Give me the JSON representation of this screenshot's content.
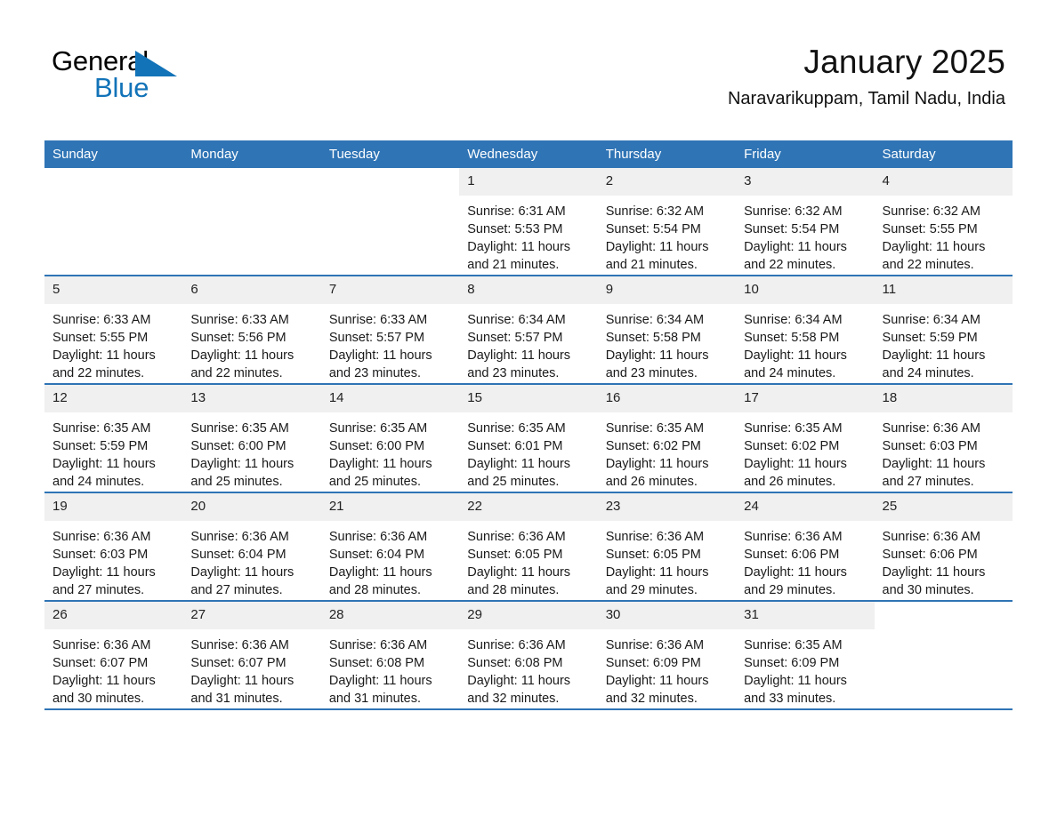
{
  "brand": {
    "name_part1": "General",
    "name_part2": "Blue",
    "accent_color": "#1273b8"
  },
  "header": {
    "title": "January 2025",
    "subtitle": "Naravarikuppam, Tamil Nadu, India",
    "header_bg_color": "#2f74b5"
  },
  "weekdays": [
    "Sunday",
    "Monday",
    "Tuesday",
    "Wednesday",
    "Thursday",
    "Friday",
    "Saturday"
  ],
  "weeks": [
    [
      {
        "day": "",
        "sunrise": "",
        "sunset": "",
        "daylight_line1": "",
        "daylight_line2": ""
      },
      {
        "day": "",
        "sunrise": "",
        "sunset": "",
        "daylight_line1": "",
        "daylight_line2": ""
      },
      {
        "day": "",
        "sunrise": "",
        "sunset": "",
        "daylight_line1": "",
        "daylight_line2": ""
      },
      {
        "day": "1",
        "sunrise": "Sunrise: 6:31 AM",
        "sunset": "Sunset: 5:53 PM",
        "daylight_line1": "Daylight: 11 hours",
        "daylight_line2": "and 21 minutes."
      },
      {
        "day": "2",
        "sunrise": "Sunrise: 6:32 AM",
        "sunset": "Sunset: 5:54 PM",
        "daylight_line1": "Daylight: 11 hours",
        "daylight_line2": "and 21 minutes."
      },
      {
        "day": "3",
        "sunrise": "Sunrise: 6:32 AM",
        "sunset": "Sunset: 5:54 PM",
        "daylight_line1": "Daylight: 11 hours",
        "daylight_line2": "and 22 minutes."
      },
      {
        "day": "4",
        "sunrise": "Sunrise: 6:32 AM",
        "sunset": "Sunset: 5:55 PM",
        "daylight_line1": "Daylight: 11 hours",
        "daylight_line2": "and 22 minutes."
      }
    ],
    [
      {
        "day": "5",
        "sunrise": "Sunrise: 6:33 AM",
        "sunset": "Sunset: 5:55 PM",
        "daylight_line1": "Daylight: 11 hours",
        "daylight_line2": "and 22 minutes."
      },
      {
        "day": "6",
        "sunrise": "Sunrise: 6:33 AM",
        "sunset": "Sunset: 5:56 PM",
        "daylight_line1": "Daylight: 11 hours",
        "daylight_line2": "and 22 minutes."
      },
      {
        "day": "7",
        "sunrise": "Sunrise: 6:33 AM",
        "sunset": "Sunset: 5:57 PM",
        "daylight_line1": "Daylight: 11 hours",
        "daylight_line2": "and 23 minutes."
      },
      {
        "day": "8",
        "sunrise": "Sunrise: 6:34 AM",
        "sunset": "Sunset: 5:57 PM",
        "daylight_line1": "Daylight: 11 hours",
        "daylight_line2": "and 23 minutes."
      },
      {
        "day": "9",
        "sunrise": "Sunrise: 6:34 AM",
        "sunset": "Sunset: 5:58 PM",
        "daylight_line1": "Daylight: 11 hours",
        "daylight_line2": "and 23 minutes."
      },
      {
        "day": "10",
        "sunrise": "Sunrise: 6:34 AM",
        "sunset": "Sunset: 5:58 PM",
        "daylight_line1": "Daylight: 11 hours",
        "daylight_line2": "and 24 minutes."
      },
      {
        "day": "11",
        "sunrise": "Sunrise: 6:34 AM",
        "sunset": "Sunset: 5:59 PM",
        "daylight_line1": "Daylight: 11 hours",
        "daylight_line2": "and 24 minutes."
      }
    ],
    [
      {
        "day": "12",
        "sunrise": "Sunrise: 6:35 AM",
        "sunset": "Sunset: 5:59 PM",
        "daylight_line1": "Daylight: 11 hours",
        "daylight_line2": "and 24 minutes."
      },
      {
        "day": "13",
        "sunrise": "Sunrise: 6:35 AM",
        "sunset": "Sunset: 6:00 PM",
        "daylight_line1": "Daylight: 11 hours",
        "daylight_line2": "and 25 minutes."
      },
      {
        "day": "14",
        "sunrise": "Sunrise: 6:35 AM",
        "sunset": "Sunset: 6:00 PM",
        "daylight_line1": "Daylight: 11 hours",
        "daylight_line2": "and 25 minutes."
      },
      {
        "day": "15",
        "sunrise": "Sunrise: 6:35 AM",
        "sunset": "Sunset: 6:01 PM",
        "daylight_line1": "Daylight: 11 hours",
        "daylight_line2": "and 25 minutes."
      },
      {
        "day": "16",
        "sunrise": "Sunrise: 6:35 AM",
        "sunset": "Sunset: 6:02 PM",
        "daylight_line1": "Daylight: 11 hours",
        "daylight_line2": "and 26 minutes."
      },
      {
        "day": "17",
        "sunrise": "Sunrise: 6:35 AM",
        "sunset": "Sunset: 6:02 PM",
        "daylight_line1": "Daylight: 11 hours",
        "daylight_line2": "and 26 minutes."
      },
      {
        "day": "18",
        "sunrise": "Sunrise: 6:36 AM",
        "sunset": "Sunset: 6:03 PM",
        "daylight_line1": "Daylight: 11 hours",
        "daylight_line2": "and 27 minutes."
      }
    ],
    [
      {
        "day": "19",
        "sunrise": "Sunrise: 6:36 AM",
        "sunset": "Sunset: 6:03 PM",
        "daylight_line1": "Daylight: 11 hours",
        "daylight_line2": "and 27 minutes."
      },
      {
        "day": "20",
        "sunrise": "Sunrise: 6:36 AM",
        "sunset": "Sunset: 6:04 PM",
        "daylight_line1": "Daylight: 11 hours",
        "daylight_line2": "and 27 minutes."
      },
      {
        "day": "21",
        "sunrise": "Sunrise: 6:36 AM",
        "sunset": "Sunset: 6:04 PM",
        "daylight_line1": "Daylight: 11 hours",
        "daylight_line2": "and 28 minutes."
      },
      {
        "day": "22",
        "sunrise": "Sunrise: 6:36 AM",
        "sunset": "Sunset: 6:05 PM",
        "daylight_line1": "Daylight: 11 hours",
        "daylight_line2": "and 28 minutes."
      },
      {
        "day": "23",
        "sunrise": "Sunrise: 6:36 AM",
        "sunset": "Sunset: 6:05 PM",
        "daylight_line1": "Daylight: 11 hours",
        "daylight_line2": "and 29 minutes."
      },
      {
        "day": "24",
        "sunrise": "Sunrise: 6:36 AM",
        "sunset": "Sunset: 6:06 PM",
        "daylight_line1": "Daylight: 11 hours",
        "daylight_line2": "and 29 minutes."
      },
      {
        "day": "25",
        "sunrise": "Sunrise: 6:36 AM",
        "sunset": "Sunset: 6:06 PM",
        "daylight_line1": "Daylight: 11 hours",
        "daylight_line2": "and 30 minutes."
      }
    ],
    [
      {
        "day": "26",
        "sunrise": "Sunrise: 6:36 AM",
        "sunset": "Sunset: 6:07 PM",
        "daylight_line1": "Daylight: 11 hours",
        "daylight_line2": "and 30 minutes."
      },
      {
        "day": "27",
        "sunrise": "Sunrise: 6:36 AM",
        "sunset": "Sunset: 6:07 PM",
        "daylight_line1": "Daylight: 11 hours",
        "daylight_line2": "and 31 minutes."
      },
      {
        "day": "28",
        "sunrise": "Sunrise: 6:36 AM",
        "sunset": "Sunset: 6:08 PM",
        "daylight_line1": "Daylight: 11 hours",
        "daylight_line2": "and 31 minutes."
      },
      {
        "day": "29",
        "sunrise": "Sunrise: 6:36 AM",
        "sunset": "Sunset: 6:08 PM",
        "daylight_line1": "Daylight: 11 hours",
        "daylight_line2": "and 32 minutes."
      },
      {
        "day": "30",
        "sunrise": "Sunrise: 6:36 AM",
        "sunset": "Sunset: 6:09 PM",
        "daylight_line1": "Daylight: 11 hours",
        "daylight_line2": "and 32 minutes."
      },
      {
        "day": "31",
        "sunrise": "Sunrise: 6:35 AM",
        "sunset": "Sunset: 6:09 PM",
        "daylight_line1": "Daylight: 11 hours",
        "daylight_line2": "and 33 minutes."
      },
      {
        "day": "",
        "sunrise": "",
        "sunset": "",
        "daylight_line1": "",
        "daylight_line2": ""
      }
    ]
  ]
}
